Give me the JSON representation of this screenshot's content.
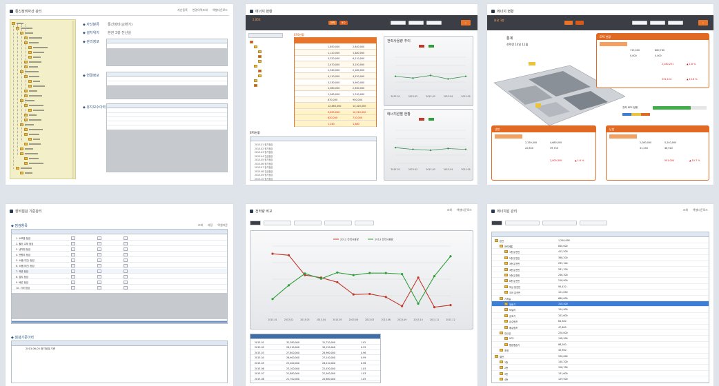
{
  "colors": {
    "background": "#dfe4ea",
    "accent": "#e8742a",
    "callout_orange": "#e06a23",
    "tree_folder": "#e3b94b",
    "chart_red": "#c0392b",
    "chart_green": "#2e9e3b",
    "selection_blue": "#3d7ed8",
    "grid_header": "#e7edf4"
  },
  "icons": [
    "window-icon",
    "folder-icon",
    "document-icon",
    "search-icon",
    "dropdown-icon",
    "calendar-icon"
  ],
  "panels": {
    "p1": {
      "title": "통신장비자산 관리",
      "links": [
        "자산등록",
        "변경이력조회",
        "엑셀다운로드"
      ],
      "form_labels": [
        "◆ 자산분류",
        "◆ 설치위치",
        "◆ 관리정보",
        "◆ 연결정보",
        "◆ 유지보수이력"
      ],
      "form_values": [
        "통신장비(교환기)",
        "본관 3층 전산실"
      ]
    },
    "p2": {
      "title": "에너지 현황",
      "selected": "2,850",
      "chips": [
        "전력",
        "용수"
      ],
      "section_labels": [
        "EPS현황",
        "EPS현황",
        "전력사용량 추이",
        "에너지원별 현황"
      ],
      "table_values": [
        [
          "1,850,000",
          "2,640,000"
        ],
        [
          "1,120,000",
          "1,480,000"
        ],
        [
          "5,320,000",
          "6,210,000"
        ],
        [
          "2,470,000",
          "3,150,000"
        ],
        [
          "1,940,000",
          "2,180,000"
        ],
        [
          "4,110,000",
          "4,520,000"
        ],
        [
          "3,330,000",
          "3,900,000"
        ],
        [
          "2,080,000",
          "2,360,000"
        ],
        [
          "1,560,000",
          "1,740,000"
        ],
        [
          "870,000",
          "950,000"
        ],
        [
          "12,480,000",
          "14,320,000"
        ],
        [
          "9,650,000",
          "10,210,000"
        ],
        [
          "620,000",
          "710,000"
        ],
        [
          "1,240",
          "1,380"
        ]
      ],
      "list_rows": [
        "2013-01 정기점검",
        "2013-02 정기점검",
        "2013-03 정기점검",
        "2013-04 긴급점검",
        "2013-05 정기점검",
        "2013-06 정기점검",
        "2013-07 정기점검",
        "2013-08 긴급점검",
        "2013-09 정기점검",
        "2013-10 정기점검"
      ],
      "chart_a": {
        "type": "line",
        "categories": [
          "2013-01",
          "2013-02",
          "2013-03",
          "2013-04",
          "2013-05"
        ],
        "series": [
          {
            "values": [
              46,
              44,
              47,
              43,
              46
            ]
          }
        ]
      },
      "chart_b": {
        "type": "line",
        "categories": [
          "2013-01",
          "2013-02",
          "2013-03",
          "2013-04",
          "2013-05"
        ],
        "series": [
          {
            "values": [
              48,
              46,
              45,
              47,
              46
            ]
          }
        ]
      }
    },
    "p3": {
      "title": "에너지 현황",
      "badge": "본관 3층",
      "heading": "통계",
      "sub_heading": "전력량 14일 11월",
      "callout_titles": [
        "EPS 현황",
        "냉방",
        "난방"
      ],
      "pairs": [
        [
          "715,000",
          "860,760"
        ],
        [
          "0,000",
          "0.000"
        ],
        [
          "2,150,000",
          "4,680,000"
        ],
        [
          "22,830",
          "39,730"
        ],
        [
          "2,080,000",
          "5,240,000"
        ],
        [
          "31,230",
          "46,910"
        ]
      ],
      "red_numbers": [
        "2,180,251",
        "▲ 1.8 %",
        "331,124",
        "▲ 10.8 %",
        "2,000,300",
        "▲ 1.6 %",
        "231,000",
        "▲ 12.7 %",
        "501,000",
        "▲ 10.7 %"
      ],
      "gauge_label": "전력 EPS 현황"
    },
    "p4": {
      "title": "장비점검 기준관리",
      "links": [
        "조회",
        "저장",
        "엑셀다운"
      ],
      "section1": "◆ 점검항목",
      "section2": "◆ 점검기준이력",
      "rows": [
        "1. 소모품 점검",
        "2. 필터 교체 점검",
        "3. 냉각팬 점검",
        "4. 전원부 점검",
        "5. 소음(주간) 점검",
        "6. 소음(야간) 점검",
        "7. 외관 점검",
        "8. 접지 점검",
        "9. 배선 점검",
        "10. 기타 점검"
      ],
      "sub_rows": [
        "2013-06-05 정기점검 기준"
      ]
    },
    "p5": {
      "title": "전력량 비교",
      "links": [
        "조회",
        "엑셀다운로드"
      ],
      "legend": [
        "2012 전력사용량",
        "2013 전력사용량"
      ],
      "chart": {
        "type": "line",
        "categories": [
          "2013-01",
          "2013-02",
          "2013-03",
          "2013-04",
          "2013-05",
          "2013-06",
          "2013-07",
          "2013-08",
          "2013-09",
          "2013-10",
          "2013-11",
          "2013-12"
        ],
        "series": [
          {
            "color": "#c0392b",
            "values": [
              175,
              172,
              133,
              128,
              119,
              95,
              96,
              90,
              72,
              128,
              70,
              74
            ]
          },
          {
            "color": "#2e9e3b",
            "values": [
              86,
              113,
              136,
              126,
              138,
              133,
              137,
              137,
              135,
              77,
              131,
              170
            ]
          }
        ],
        "ylim": [
          60,
          190
        ]
      },
      "table": [
        [
          "2013-01",
          "32,380,000",
          "31,720,000",
          "1.02"
        ],
        [
          "2013-02",
          "28,510,000",
          "30,150,000",
          "0.95"
        ],
        [
          "2013-03",
          "27,800,000",
          "28,960,000",
          "0.96"
        ],
        [
          "2013-04",
          "26,900,000",
          "27,140,000",
          "0.99"
        ],
        [
          "2013-05",
          "25,400,000",
          "26,010,000",
          "0.98"
        ],
        [
          "2013-06",
          "23,100,000",
          "22,450,000",
          "1.03"
        ],
        [
          "2013-07",
          "22,880,000",
          "22,300,000",
          "1.03"
        ],
        [
          "2013-08",
          "21,700,000",
          "20,680,000",
          "1.05"
        ]
      ]
    },
    "p6": {
      "title": "에너지원 관리",
      "links": [
        "조회",
        "엑셀다운로드"
      ],
      "nodes": [
        "본관",
        "전력계통",
        "1층 분전반",
        "2층 분전반",
        "3층 분전반",
        "4층 분전반",
        "5층 분전반",
        "6층 분전반",
        "옥상 분전반",
        "지하 분전반",
        "기계실",
        "냉동기",
        "보일러",
        "공조기",
        "급수펌프",
        "배수펌프",
        "전산실",
        "UPS",
        "항온항습기",
        "조명",
        "별관",
        "1층",
        "2층",
        "3층",
        "4층"
      ],
      "values": [
        "1,250,000",
        "840,000",
        "412,500",
        "388,200",
        "295,100",
        "281,700",
        "246,300",
        "218,900",
        "95,420",
        "121,050",
        "680,000",
        "310,400",
        "154,900",
        "102,600",
        "64,300",
        "47,800",
        "220,000",
        "118,500",
        "86,200",
        "45,900",
        "530,000",
        "140,200",
        "128,700",
        "131,600",
        "129,500"
      ],
      "selected_index": 11
    }
  }
}
